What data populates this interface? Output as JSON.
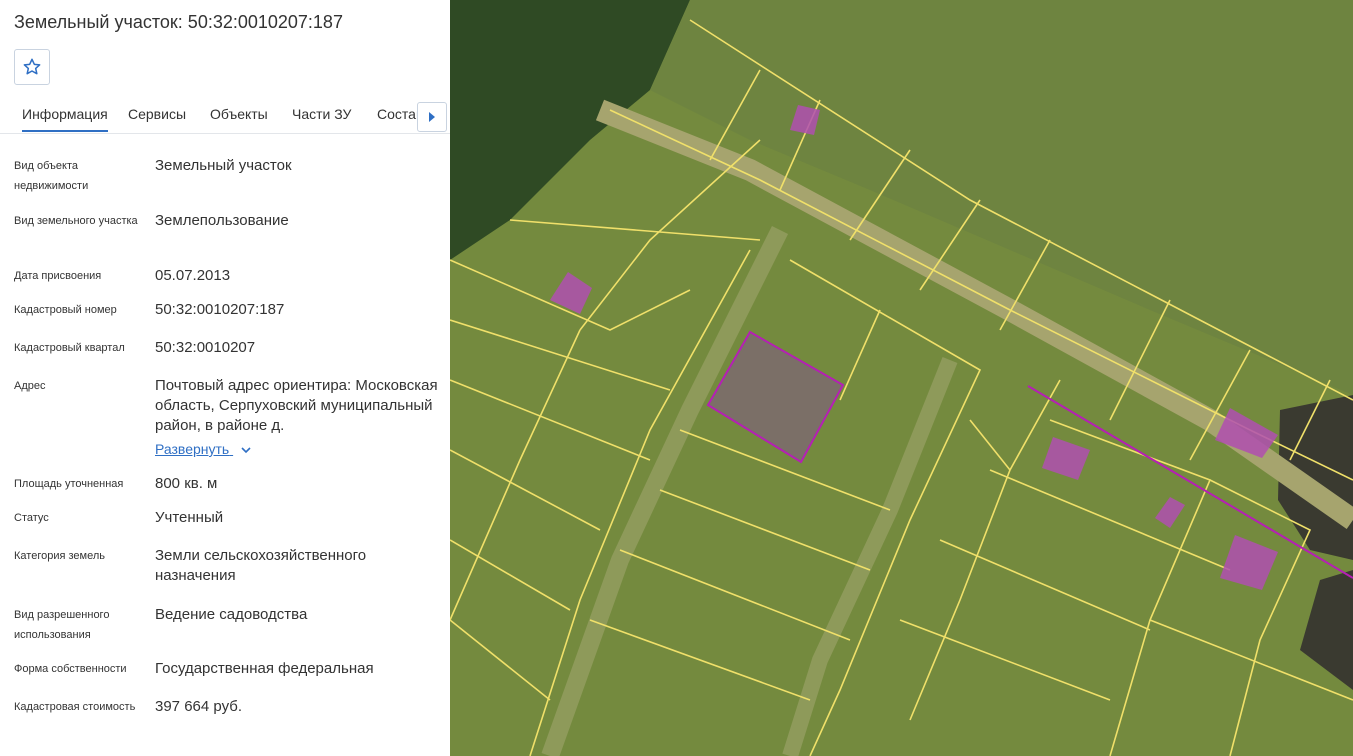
{
  "panel": {
    "title": "Земельный участок: 50:32:0010207:187",
    "favorite_icon": "star-outline-icon",
    "tabs": [
      {
        "label": "Информация",
        "active": true
      },
      {
        "label": "Сервисы"
      },
      {
        "label": "Объекты"
      },
      {
        "label": "Части ЗУ"
      },
      {
        "label": "Состав"
      }
    ],
    "tab_scroll_icon": "caret-right-icon",
    "fields": [
      {
        "label": "Вид объекта недвижимости",
        "value": "Земельный участок"
      },
      {
        "label": "Вид земельного участка",
        "value": "Землепользование"
      },
      {
        "label": "Дата присвоения",
        "value": "05.07.2013"
      },
      {
        "label": "Кадастровый номер",
        "value": "50:32:0010207:187"
      },
      {
        "label": "Кадастровый квартал",
        "value": "50:32:0010207"
      },
      {
        "label": "Адрес",
        "value": "Почтовый адрес ориентира: Московская область, Серпуховский муниципальный район, в районе д.",
        "expand_label": "Развернуть"
      },
      {
        "label": "Площадь уточненная",
        "value": "800 кв. м"
      },
      {
        "label": "Статус",
        "value": "Учтенный"
      },
      {
        "label": "Категория земель",
        "value": "Земли сельскохозяйственного назначения"
      },
      {
        "label": "Вид разрешенного использования",
        "value": "Ведение садоводства"
      },
      {
        "label": "Форма собственности",
        "value": "Государственная федеральная"
      },
      {
        "label": "Кадастровая стоимость",
        "value": "397 664 руб."
      }
    ]
  },
  "map": {
    "colors": {
      "field": "#748a3e",
      "forest": "#2f4a24",
      "road": "#a6a46e",
      "parcel_line": "#f0e06a",
      "building": "#b04fb0",
      "selected_fill": "#7d6a6e",
      "selected_stroke": "#b51fb5"
    }
  }
}
